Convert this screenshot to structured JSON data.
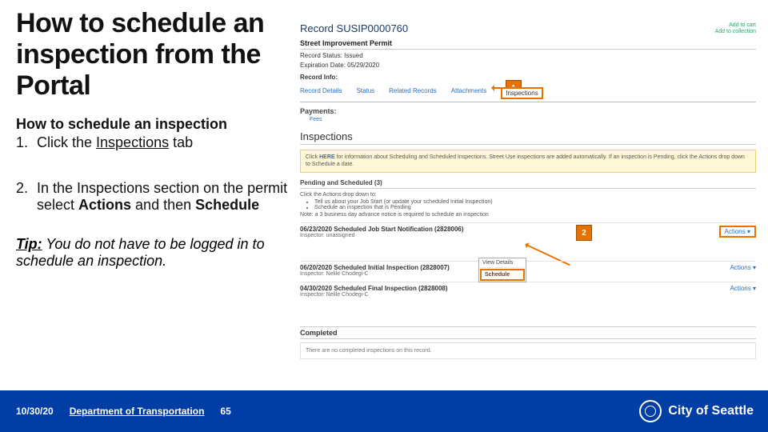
{
  "title": "How to schedule an inspection from the Portal",
  "subhead": "How to schedule an inspection",
  "steps": {
    "s1": {
      "num": "1.",
      "pre": "Click the ",
      "key": "Inspections",
      "post": " tab"
    },
    "s2": {
      "num": "2.",
      "pre": "In the Inspections section on the permit select ",
      "k1": "Actions",
      "mid": " and then ",
      "k2": "Schedule"
    }
  },
  "tip": {
    "lead": "Tip:",
    "body": " You do not have to be logged in to schedule an inspection."
  },
  "footer": {
    "date": "10/30/20",
    "dept": "Department of Transportation",
    "page": "65",
    "logo": "City of Seattle"
  },
  "callouts": {
    "c1": "1",
    "c2": "2"
  },
  "shot": {
    "record_title": "Record SUSIP0000760",
    "add_cart": "Add to cart",
    "add_coll": "Add to collection",
    "permit_hdr": "Street Improvement Permit",
    "status_lbl": "Record Status: Issued",
    "exp_lbl": "Expiration Date: 05/29/2020",
    "info_hdr": "Record Info:",
    "tabs": {
      "details": "Record Details",
      "status": "Status",
      "related": "Related Records",
      "attach": "Attachments",
      "insp": "Inspections"
    },
    "pay_hdr": "Payments:",
    "fees": "Fees",
    "insp_section": "Inspections",
    "yellow_pre": "Click ",
    "yellow_here": "HERE",
    "yellow_post": " for information about Scheduling and Scheduled Inspections. Street Use inspections are added automatically. If an inspection is Pending, click the Actions drop down to Schedule a date.",
    "pending_hdr": "Pending and Scheduled (3)",
    "inst_lead": "Click the Actions drop down to:",
    "inst_b1": "Tell us about your Job Start (or update your scheduled Initial Inspection)",
    "inst_b2": "Schedule an inspection that is Pending",
    "inst_note": "Note: a 3 business day advance notice is required to schedule an inspection",
    "item1_t": "06/23/2020 Scheduled Job Start Notification (2828006)",
    "item1_s": "Inspector: unassigned",
    "item2_t": "06/20/2020 Scheduled Initial Inspection (2828007)",
    "item2_s": "Inspector: Nelile Chodegi-C",
    "item3_t": "04/30/2020 Scheduled Final Inspection (2828008)",
    "item3_s": "Inspector: Nelile Chodegi-C",
    "actions": "Actions ▾",
    "dd_view": "View Details",
    "dd_sched": "Schedule",
    "completed": "Completed",
    "none": "There are no completed inspections on this record."
  }
}
